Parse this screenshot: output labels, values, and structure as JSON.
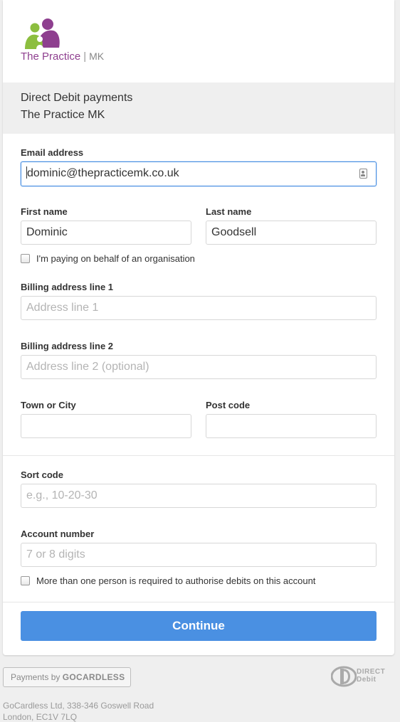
{
  "logo": {
    "brand": "The Practice",
    "separator": "|",
    "suffix": "MK"
  },
  "merchant": {
    "line1": "Direct Debit payments",
    "line2": "The Practice MK"
  },
  "form": {
    "email": {
      "label": "Email address",
      "value": "dominic@thepracticemk.co.uk"
    },
    "first_name": {
      "label": "First name",
      "value": "Dominic"
    },
    "last_name": {
      "label": "Last name",
      "value": "Goodsell"
    },
    "organisation_checkbox": {
      "label": "I'm paying on behalf of an organisation",
      "checked": false
    },
    "address1": {
      "label": "Billing address line 1",
      "placeholder": "Address line 1"
    },
    "address2": {
      "label": "Billing address line 2",
      "placeholder": "Address line 2 (optional)"
    },
    "town": {
      "label": "Town or City",
      "value": ""
    },
    "postcode": {
      "label": "Post code",
      "value": ""
    },
    "sort_code": {
      "label": "Sort code",
      "placeholder": "e.g., 10-20-30"
    },
    "account_number": {
      "label": "Account number",
      "placeholder": "7 or 8 digits"
    },
    "multi_auth_checkbox": {
      "label": "More than one person is required to authorise debits on this account",
      "checked": false
    },
    "continue_label": "Continue"
  },
  "footer": {
    "badge_prefix": "Payments by",
    "badge_brand": "GOCARDLESS",
    "dd_logo_line1": "DIRECT",
    "dd_logo_line2": "Debit",
    "address_line1": "GoCardless Ltd, 338-346 Goswell Road",
    "address_line2": "London, EC1V 7LQ"
  },
  "colors": {
    "accent": "#4a90e2",
    "brand_purple": "#8e3f8f",
    "brand_green": "#8cbe3f"
  }
}
